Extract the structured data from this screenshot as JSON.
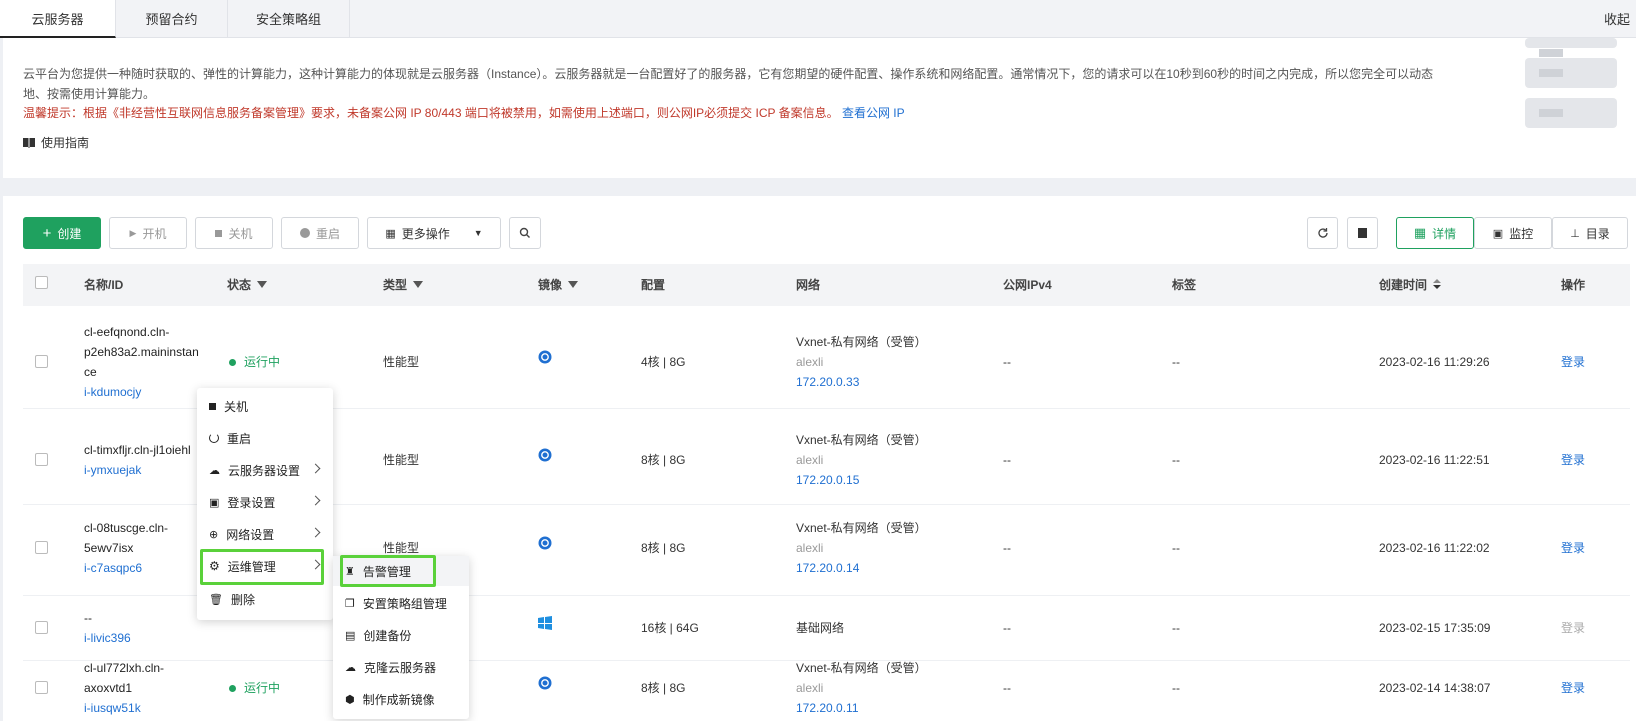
{
  "tabs": [
    "云服务器",
    "预留合约",
    "安全策略组"
  ],
  "collapse_label": "收起",
  "intro": {
    "text": "云平台为您提供一种随时获取的、弹性的计算能力，这种计算能力的体现就是云服务器（Instance）。云服务器就是一台配置好了的服务器，它有您期望的硬件配置、操作系统和网络配置。通常情况下，您的请求可以在10秒到60秒的时间之内完成，所以您完全可以动态地、按需使用计算能力。",
    "warning": "温馨提示：根据《非经营性互联网信息服务备案管理》要求，未备案公网 IP 80/443 端口将被禁用，如需使用上述端口，则公网IP必须提交 ICP 备案信息。",
    "warning_link": "查看公网 IP",
    "guide": "使用指南"
  },
  "toolbar": {
    "create": "创建",
    "start": "开机",
    "stop": "关机",
    "restart": "重启",
    "more": "更多操作",
    "detail": "详情",
    "monitor": "监控",
    "catalog": "目录"
  },
  "columns": {
    "name": "名称/ID",
    "status": "状态",
    "type": "类型",
    "image": "镜像",
    "config": "配置",
    "network": "网络",
    "ipv4": "公网IPv4",
    "tags": "标签",
    "created": "创建时间",
    "actions": "操作"
  },
  "rows": [
    {
      "name1": "cl-eefqnond.cln-",
      "name2": "p2eh83a2.maininstan",
      "name3": "ce",
      "id": "i-kdumocjy",
      "status": "运行中",
      "type": "性能型",
      "os": "linux",
      "config": "4核 | 8G",
      "net": "Vxnet-私有网络（受管）",
      "owner": "alexli",
      "ip": "172.20.0.33",
      "ipv4": "--",
      "tags": "--",
      "created": "2023-02-16 11:29:26",
      "action": "登录"
    },
    {
      "name1": "cl-timxfljr.cln-jl1oiehl",
      "name2": "",
      "name3": "",
      "id": "i-ymxuejak",
      "status": "",
      "type": "性能型",
      "os": "linux",
      "config": "8核 | 8G",
      "net": "Vxnet-私有网络（受管）",
      "owner": "alexli",
      "ip": "172.20.0.15",
      "ipv4": "--",
      "tags": "--",
      "created": "2023-02-16 11:22:51",
      "action": "登录"
    },
    {
      "name1": "cl-08tuscge.cln-",
      "name2": "5ewv7isx",
      "name3": "",
      "id": "i-c7asqpc6",
      "status": "",
      "type": "性能型",
      "os": "linux",
      "config": "8核 | 8G",
      "net": "Vxnet-私有网络（受管）",
      "owner": "alexli",
      "ip": "172.20.0.14",
      "ipv4": "--",
      "tags": "--",
      "created": "2023-02-16 11:22:02",
      "action": "登录"
    },
    {
      "name1": "--",
      "name2": "",
      "name3": "",
      "id": "i-livic396",
      "status": "",
      "type": "",
      "os": "windows",
      "config": "16核 | 64G",
      "net": "基础网络",
      "owner": "",
      "ip": "",
      "ipv4": "--",
      "tags": "--",
      "created": "2023-02-15 17:35:09",
      "action": "登录"
    },
    {
      "name1": "cl-ul772lxh.cln-",
      "name2": "axoxvtd1",
      "name3": "",
      "id": "i-iusqw51k",
      "status": "运行中",
      "type": "",
      "os": "linux",
      "config": "8核 | 8G",
      "net": "Vxnet-私有网络（受管）",
      "owner": "alexli",
      "ip": "172.20.0.11",
      "ipv4": "--",
      "tags": "--",
      "created": "2023-02-14 14:38:07",
      "action": "登录"
    }
  ],
  "context_menu": [
    "关机",
    "重启",
    "云服务器设置",
    "登录设置",
    "网络设置",
    "运维管理",
    "删除"
  ],
  "submenu": [
    "告警管理",
    "安置策略组管理",
    "创建备份",
    "克隆云服务器",
    "制作成新镜像"
  ],
  "colors": {
    "primary": "#1fa15f",
    "link": "#1f6fd1",
    "warning": "#c0392b",
    "highlight": "#5ad13a"
  }
}
